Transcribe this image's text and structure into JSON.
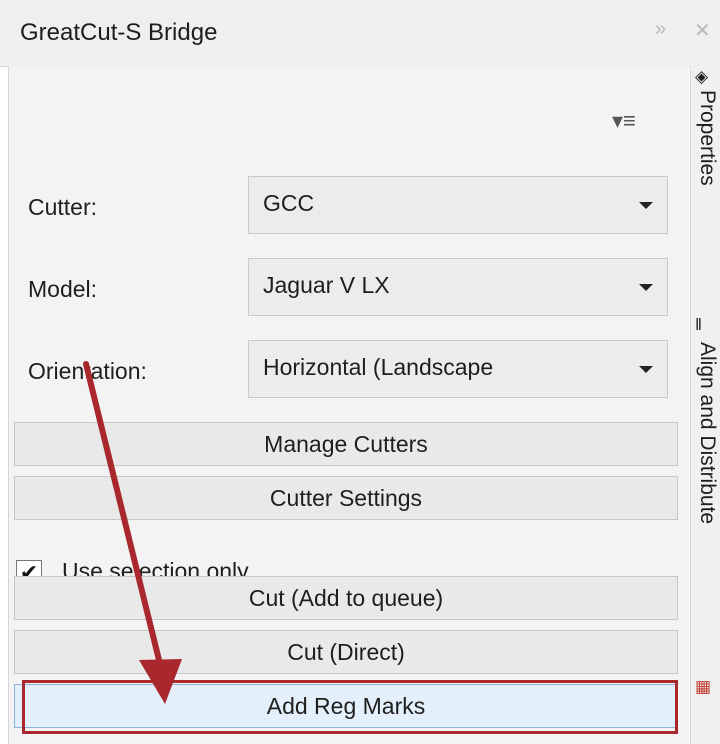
{
  "window": {
    "title": "GreatCut-S Bridge"
  },
  "sidebar": {
    "tabs": [
      {
        "label": "Properties"
      },
      {
        "label": "Align and Distribute"
      }
    ]
  },
  "form": {
    "cutter": {
      "label": "Cutter:",
      "value": "GCC"
    },
    "model": {
      "label": "Model:",
      "value": "Jaguar V LX"
    },
    "orientation": {
      "label": "Orientation:",
      "value": "Horizontal (Landscape"
    }
  },
  "buttons": {
    "manage_cutters": "Manage Cutters",
    "cutter_settings": "Cutter Settings",
    "cut_queue": "Cut (Add to queue)",
    "cut_direct": "Cut (Direct)",
    "add_reg_marks": "Add Reg Marks"
  },
  "use_selection": {
    "label": "Use selection only",
    "checked": true
  },
  "annotation": {
    "color": "#a8282e"
  }
}
